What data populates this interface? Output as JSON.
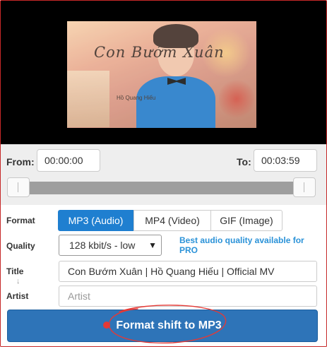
{
  "video": {
    "thumbnail_icon": "music-video-thumbnail",
    "title_script": "Con Bướm Xuân",
    "artist_tag": "Hồ Quang Hiếu"
  },
  "range": {
    "from_label": "From:",
    "from_value": "00:00:00",
    "to_label": "To:",
    "to_value": "00:03:59"
  },
  "format": {
    "label": "Format",
    "options": [
      {
        "label": "MP3 (Audio)",
        "active": true
      },
      {
        "label": "MP4 (Video)",
        "active": false
      },
      {
        "label": "GIF (Image)",
        "active": false
      }
    ]
  },
  "quality": {
    "label": "Quality",
    "selected": "128 kbit/s - low",
    "note": "Best audio quality available for PRO"
  },
  "title": {
    "label": "Title",
    "value": "Con Bướm Xuân | Hồ Quang Hiếu | Official MV"
  },
  "artist": {
    "label": "Artist",
    "placeholder": "Artist"
  },
  "action": {
    "button_label": "Format shift to MP3"
  },
  "colors": {
    "accent": "#1f7fd0",
    "button": "#2e74b8",
    "pro_note": "#2a92d8",
    "annotation": "#e53935"
  }
}
